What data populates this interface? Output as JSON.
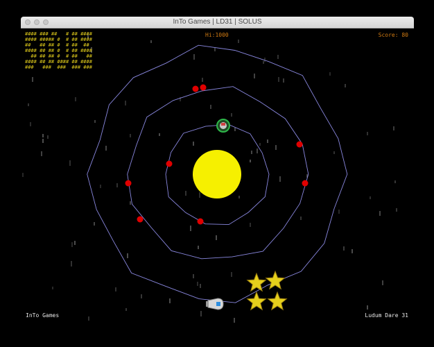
{
  "window": {
    "title": "InTo Games | LD31 | SOLUS"
  },
  "hud": {
    "hi_score": "Hi:1000",
    "score": "Score:  80"
  },
  "logo": {
    "lines": [
      "#### ### ##   # ## ####",
      "#### ##### #  # ## ####",
      "##   ## ## #  # ##  ## ",
      "#### ## ## #  # ## ####",
      "  ## ## ## #  # ##   ##",
      "#### ## ## #### ## ####",
      "###   ###  ###  ### ###"
    ]
  },
  "footer": {
    "left": "InTo Games",
    "right": "Ludum Dare 31"
  },
  "colors": {
    "background": "#000000",
    "hud_text": "#d07a12",
    "logo": "#d9c51a",
    "sun": "#f6f000",
    "orbit": "#8a88e0",
    "enemy": "#e00000",
    "star_burst": "#e5cf1c",
    "planet_ring": "#2eb84a",
    "stars": "#dddddd"
  },
  "icons": {
    "player": "spaceship-icon",
    "shield": "planet-shield-icon"
  },
  "scene": {
    "enemy_count": 8,
    "explosion_count": 4
  }
}
